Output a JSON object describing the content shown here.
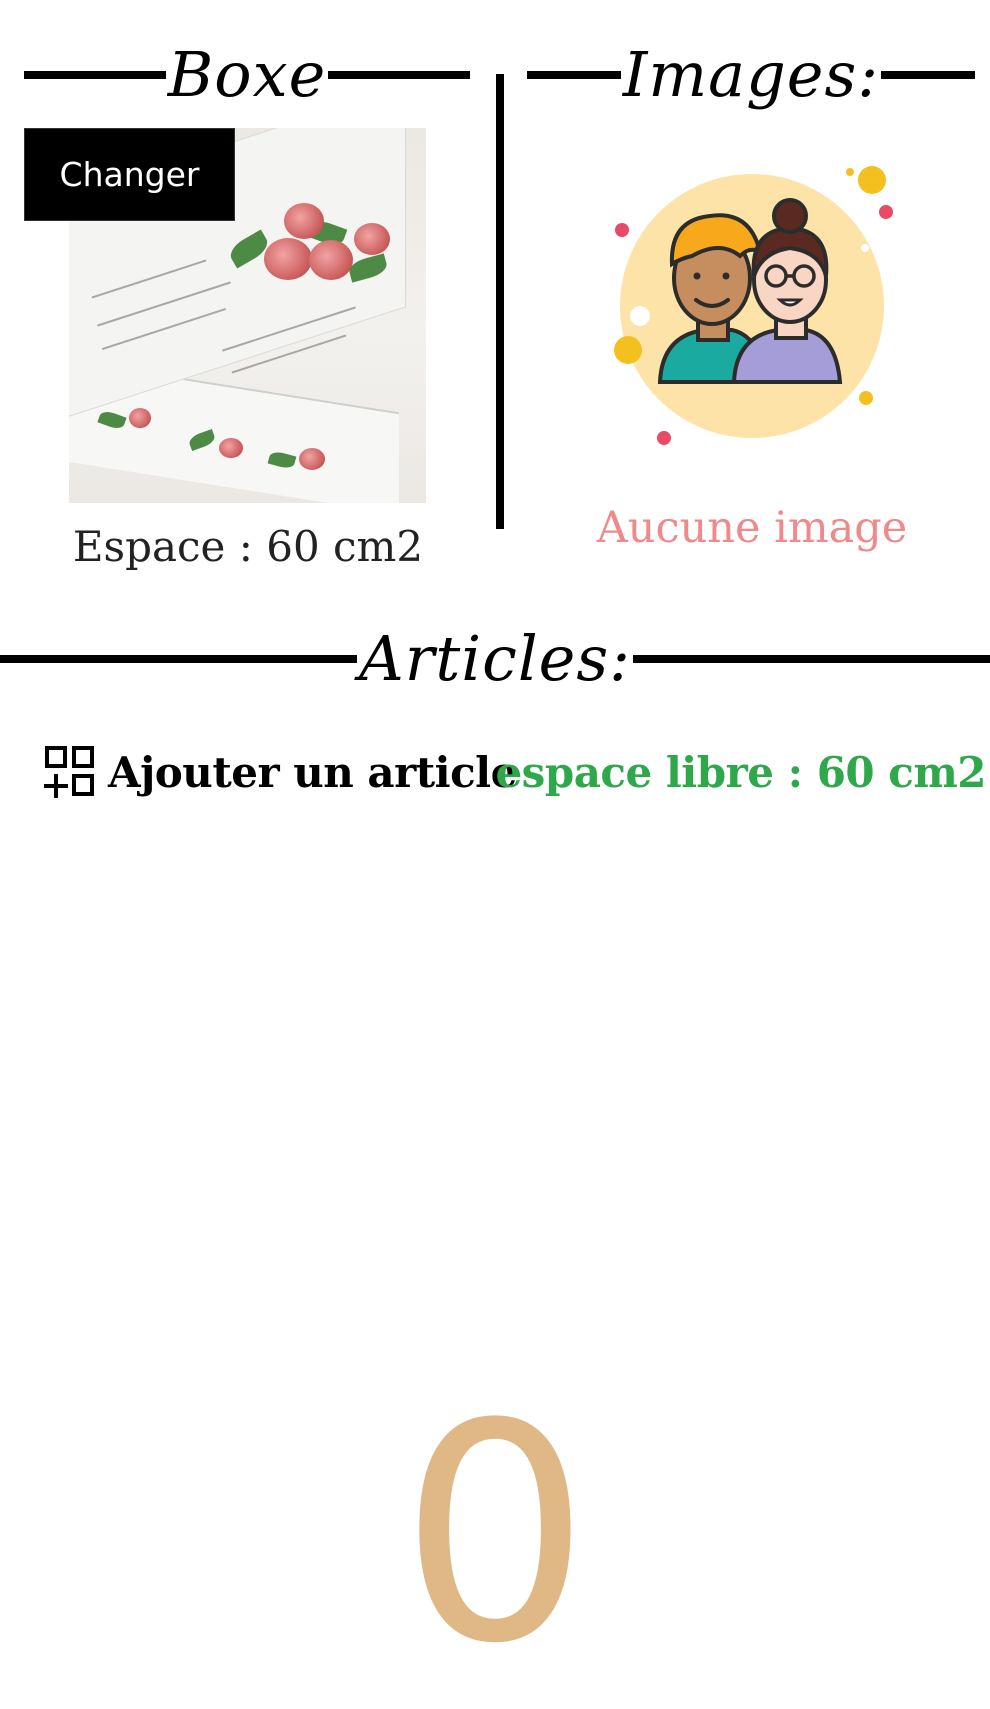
{
  "box_section": {
    "heading": "Boxe",
    "change_button_label": "Changer",
    "space_label": "Espace : 60 cm2"
  },
  "images_section": {
    "heading": "Images:",
    "empty_label": "Aucune image"
  },
  "articles_section": {
    "heading": "Articles:",
    "add_label": "Ajouter un article",
    "free_space_label": "espace libre : 60 cm2",
    "count": "0"
  },
  "colors": {
    "no_image_text": "#f08a8a",
    "free_space_text": "#2ea84a",
    "count_text": "#e0b886"
  },
  "icons": {
    "add_article": "grid-plus-icon",
    "avatar": "users-avatar-illustration"
  }
}
